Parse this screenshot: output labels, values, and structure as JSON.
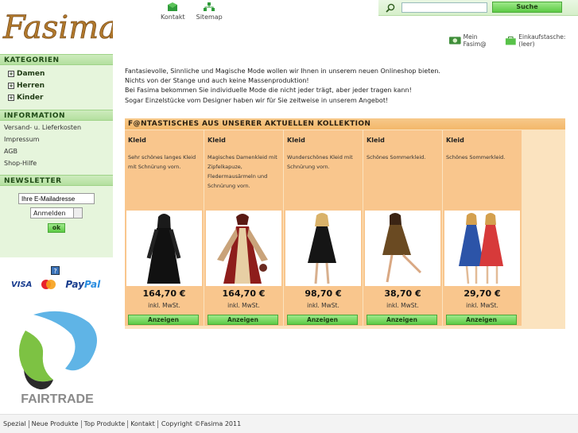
{
  "header": {
    "logo_text": "Fasima",
    "nav": [
      {
        "label": "Kontakt",
        "icon": "contact-icon"
      },
      {
        "label": "Sitemap",
        "icon": "sitemap-icon"
      }
    ],
    "search": {
      "placeholder": "",
      "value": "",
      "button_label": "Suche"
    },
    "account": {
      "mein_label": "Mein Fasim@",
      "cart_label": "Einkaufstasche: (leer)"
    }
  },
  "sidebar": {
    "categories_title": "KATEGORIEN",
    "categories": [
      {
        "label": "Damen"
      },
      {
        "label": "Herren"
      },
      {
        "label": "Kinder"
      }
    ],
    "info_title": "INFORMATION",
    "info_links": [
      {
        "label": "Versand- u. Lieferkosten"
      },
      {
        "label": "Impressum"
      },
      {
        "label": "AGB"
      },
      {
        "label": "Shop-Hilfe"
      }
    ],
    "newsletter_title": "NEWSLETTER",
    "newsletter_input_value": "Ihre E-Mailadresse",
    "newsletter_select_value": "Anmelden",
    "newsletter_ok": "ok",
    "help_icon_glyph": "?",
    "payment": {
      "visa": "VISA",
      "paypal_a": "Pay",
      "paypal_b": "Pal"
    },
    "fairtrade_text": "FAIRTRADE"
  },
  "main": {
    "intro_lines": [
      "Fantasievolle, Sinnliche und Magische Mode wollen wir Ihnen in unserem neuen Onlineshop bieten.",
      "Nichts von der Stange und auch keine Massenproduktion!",
      "Bei Fasima bekommen Sie individuelle Mode die nicht jeder trägt, aber jeder tragen kann!",
      "Sogar Einzelstücke vom Designer haben wir für Sie zeitweise in unserem Angebot!"
    ],
    "collection_title": "F@NTASTISCHES AUS UNSERER AKTUELLEN KOLLEKTION",
    "products": [
      {
        "name": "Kleid",
        "desc": "Sehr schönes langes Kleid mit Schnürung vorn.",
        "price": "164,70 €",
        "tax": "inkl. MwSt.",
        "button": "Anzeigen"
      },
      {
        "name": "Kleid",
        "desc": "Magisches Damenkleid mit Zipfelkapuze, Fledermausärmeln und Schnürung vorn.",
        "price": "164,70 €",
        "tax": "inkl. MwSt.",
        "button": "Anzeigen"
      },
      {
        "name": "Kleid",
        "desc": "Wunderschönes Kleid mit Schnürung vorn.",
        "price": "98,70 €",
        "tax": "inkl. MwSt.",
        "button": "Anzeigen"
      },
      {
        "name": "Kleid",
        "desc": "Schönes Sommerkleid.",
        "price": "38,70 €",
        "tax": "inkl. MwSt.",
        "button": "Anzeigen"
      },
      {
        "name": "Kleid",
        "desc": "Schönes Sommerkleid.",
        "price": "29,70 €",
        "tax": "inkl. MwSt.",
        "button": "Anzeigen"
      }
    ]
  },
  "footer": {
    "links": [
      {
        "label": "Spezial"
      },
      {
        "label": "Neue Produkte"
      },
      {
        "label": "Top Produkte"
      },
      {
        "label": "Kontakt"
      }
    ],
    "copyright": "Copyright ©Fasima 2011"
  },
  "colors": {
    "accent_green": "#5dcb45",
    "sidebar_bg": "#e6f5dc",
    "product_bg": "#f9c68d",
    "logo": "#b0782c"
  }
}
